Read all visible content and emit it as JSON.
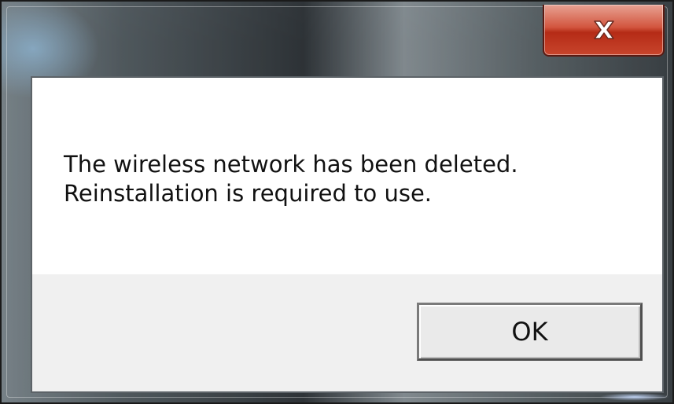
{
  "dialog": {
    "message": "The wireless network has been deleted.\nReinstallation is required to use.",
    "ok_label": "OK"
  },
  "titlebar": {
    "close_icon": "close-icon"
  },
  "colors": {
    "close_button": "#c8452c",
    "content_background": "#ffffff",
    "footer_background": "#f0f0f0"
  }
}
